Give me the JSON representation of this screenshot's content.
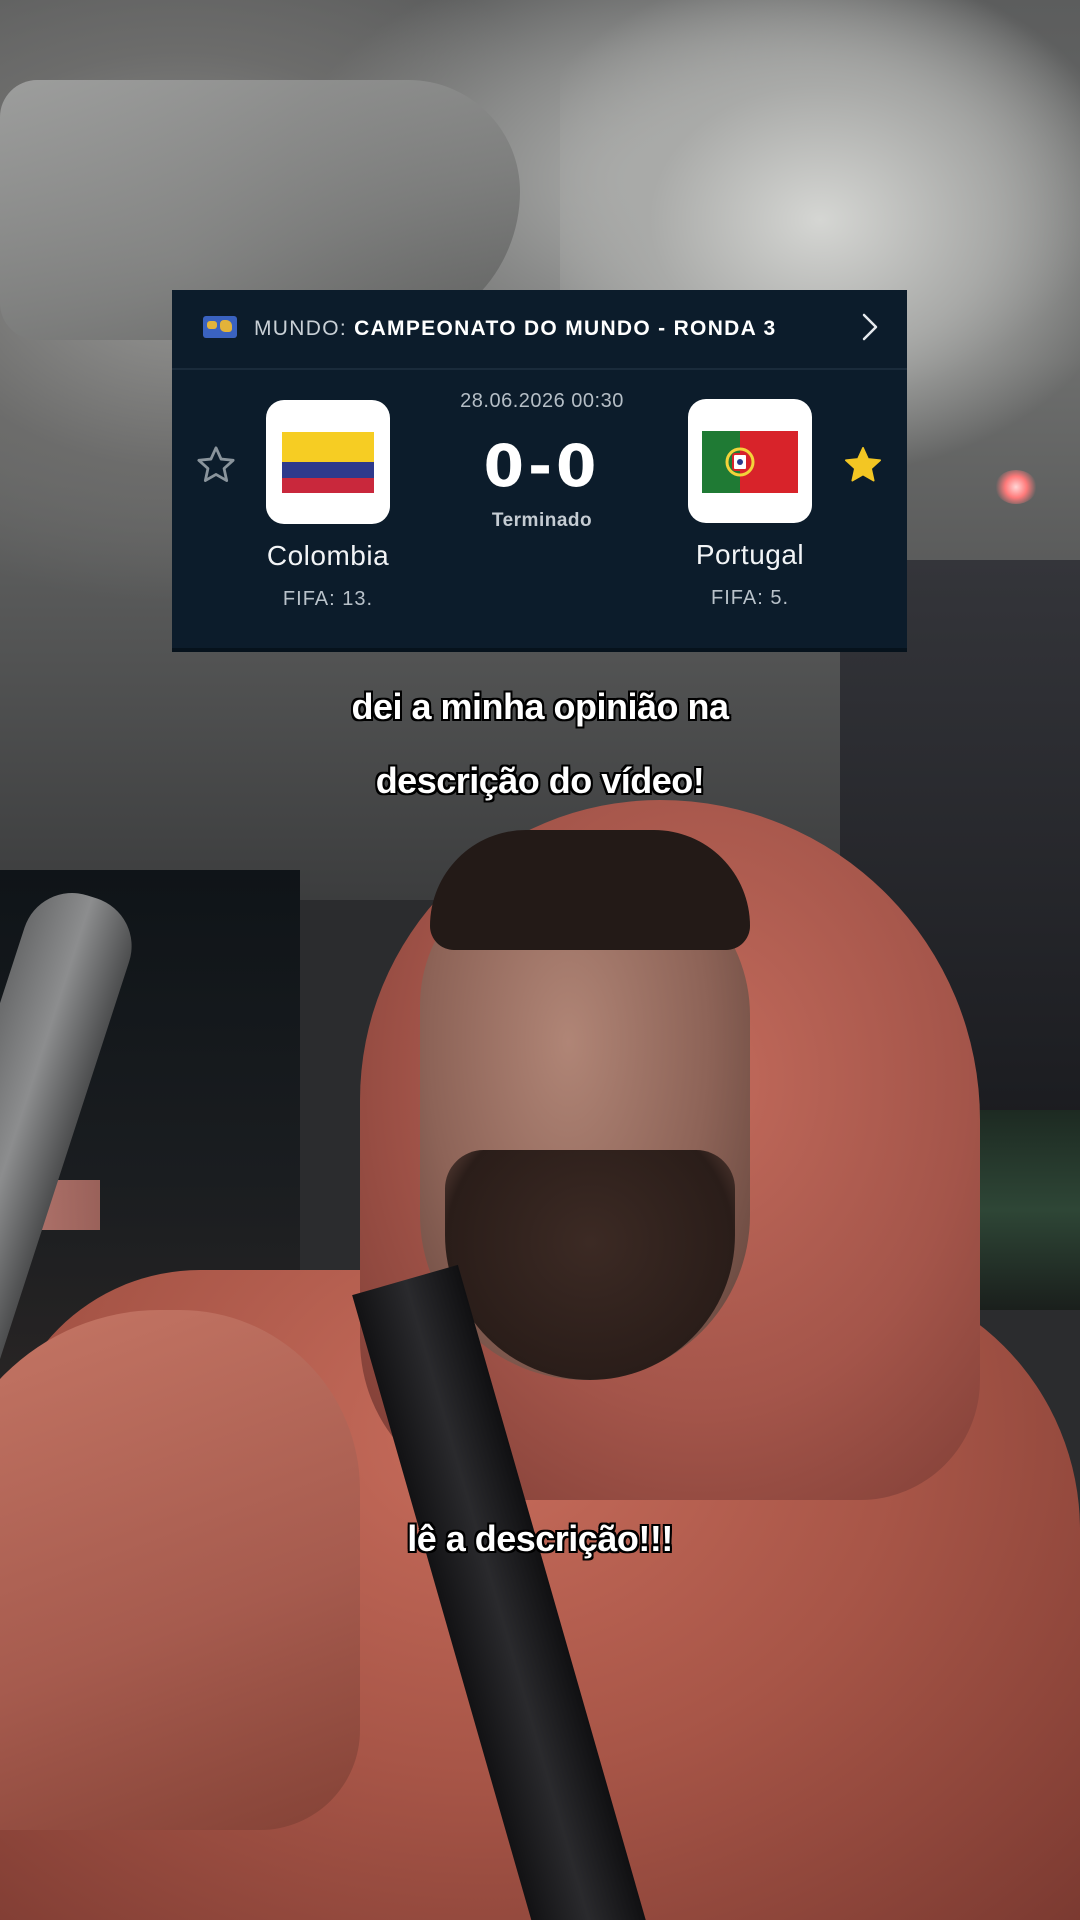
{
  "match_card": {
    "region": "MUNDO:",
    "competition": "CAMPEONATO DO MUNDO - RONDA 3",
    "datetime": "28.06.2026 00:30",
    "score": "0-0",
    "status": "Terminado",
    "home": {
      "name": "Colombia",
      "rank": "FIFA: 13.",
      "favorite": false,
      "flag_icon": "colombia-flag"
    },
    "away": {
      "name": "Portugal",
      "rank": "FIFA: 5.",
      "favorite": true,
      "flag_icon": "portugal-flag"
    },
    "colors": {
      "card_background": "#0c1c2b",
      "favorite_star": "#f3c623",
      "inactive_star": "#8a949c"
    }
  },
  "captions": {
    "line1": "dei a minha opinião na",
    "line2": "descrição do vídeo!",
    "line3": "lê a descrição!!!"
  }
}
